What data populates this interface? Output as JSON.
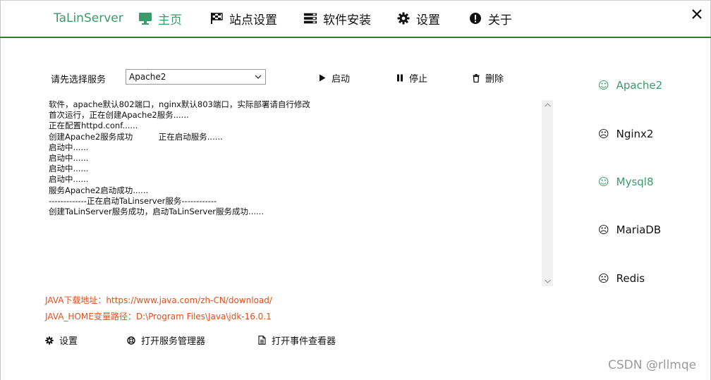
{
  "nav": {
    "brand": "TaLinServer",
    "items": [
      {
        "label": "主页",
        "icon": "monitor-icon",
        "active": true
      },
      {
        "label": "站点设置",
        "icon": "flag-icon",
        "active": false
      },
      {
        "label": "软件安装",
        "icon": "server-icon",
        "active": false
      },
      {
        "label": "设置",
        "icon": "gear-icon",
        "active": false
      },
      {
        "label": "关于",
        "icon": "exclamation-icon",
        "active": false
      }
    ],
    "close_icon": "close-icon"
  },
  "service_select": {
    "label": "请先选择服务",
    "value": "Apache2"
  },
  "actions": {
    "start": "启动",
    "stop": "停止",
    "delete": "删除"
  },
  "log": {
    "lines": [
      "软件，apache默认802端口，nginx默认803端口，实际部署请自行修改",
      "首次运行，正在创建Apache2服务......",
      "正在配置httpd.conf......",
      "创建Apache2服务成功          正在启动服务......",
      "启动中......",
      "启动中......",
      "启动中......",
      "启动中......",
      "服务Apache2启动成功......",
      "-------------正在启动TaLinserver服务------------",
      "创建TaLinServer服务成功，启动TaLinServer服务成功......"
    ]
  },
  "services": [
    {
      "name": "Apache2",
      "status": "running",
      "icon": "smile-icon"
    },
    {
      "name": "Nginx2",
      "status": "stopped",
      "icon": "frown-icon"
    },
    {
      "name": "Mysql8",
      "status": "running",
      "icon": "smile-icon"
    },
    {
      "name": "MariaDB",
      "status": "stopped",
      "icon": "frown-icon"
    },
    {
      "name": "Redis",
      "status": "stopped",
      "icon": "frown-icon"
    }
  ],
  "info": {
    "java_download": "JAVA下载地址：https://www.java.com/zh-CN/download/",
    "java_home": "JAVA_HOME变量路径：D:\\Program Files\\Java\\jdk-16.0.1"
  },
  "bottom": {
    "settings": "设置",
    "open_service_manager": "打开服务管理器",
    "open_event_viewer": "打开事件查看器"
  },
  "watermark": "CSDN @rllmqe",
  "colors": {
    "accent": "#3a9a6a",
    "nav_rule": "#2e7d32",
    "info_text": "#e0501e"
  }
}
